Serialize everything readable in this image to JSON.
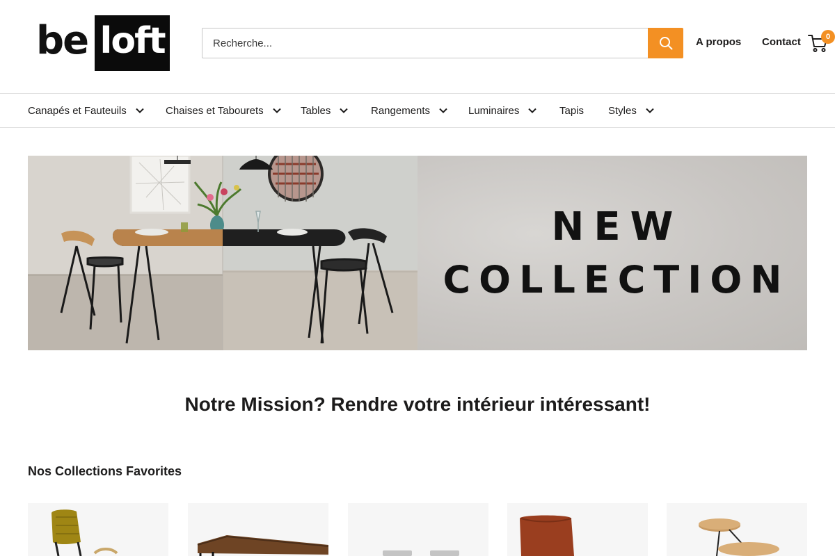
{
  "header": {
    "logo": {
      "part1": "be",
      "part2": "loft"
    },
    "search": {
      "placeholder": "Recherche..."
    },
    "links": {
      "about": "A propos",
      "contact": "Contact"
    },
    "cart_count": "0"
  },
  "nav": {
    "items": [
      {
        "label": "Canapés et Fauteuils",
        "has_dropdown": true
      },
      {
        "label": "Chaises et Tabourets",
        "has_dropdown": true
      },
      {
        "label": "Tables",
        "has_dropdown": true
      },
      {
        "label": "Rangements",
        "has_dropdown": true
      },
      {
        "label": "Luminaires",
        "has_dropdown": true
      },
      {
        "label": "Tapis",
        "has_dropdown": false
      },
      {
        "label": "Styles",
        "has_dropdown": true
      }
    ]
  },
  "banner": {
    "line1": "NEW",
    "line2": "COLLECTION"
  },
  "mission": {
    "text": "Notre Mission? Rendre votre intérieur intéressant!"
  },
  "collections": {
    "title": "Nos Collections Favorites"
  },
  "colors": {
    "accent": "#f39023",
    "text": "#1c1b1b",
    "border": "#e1e1e1"
  }
}
